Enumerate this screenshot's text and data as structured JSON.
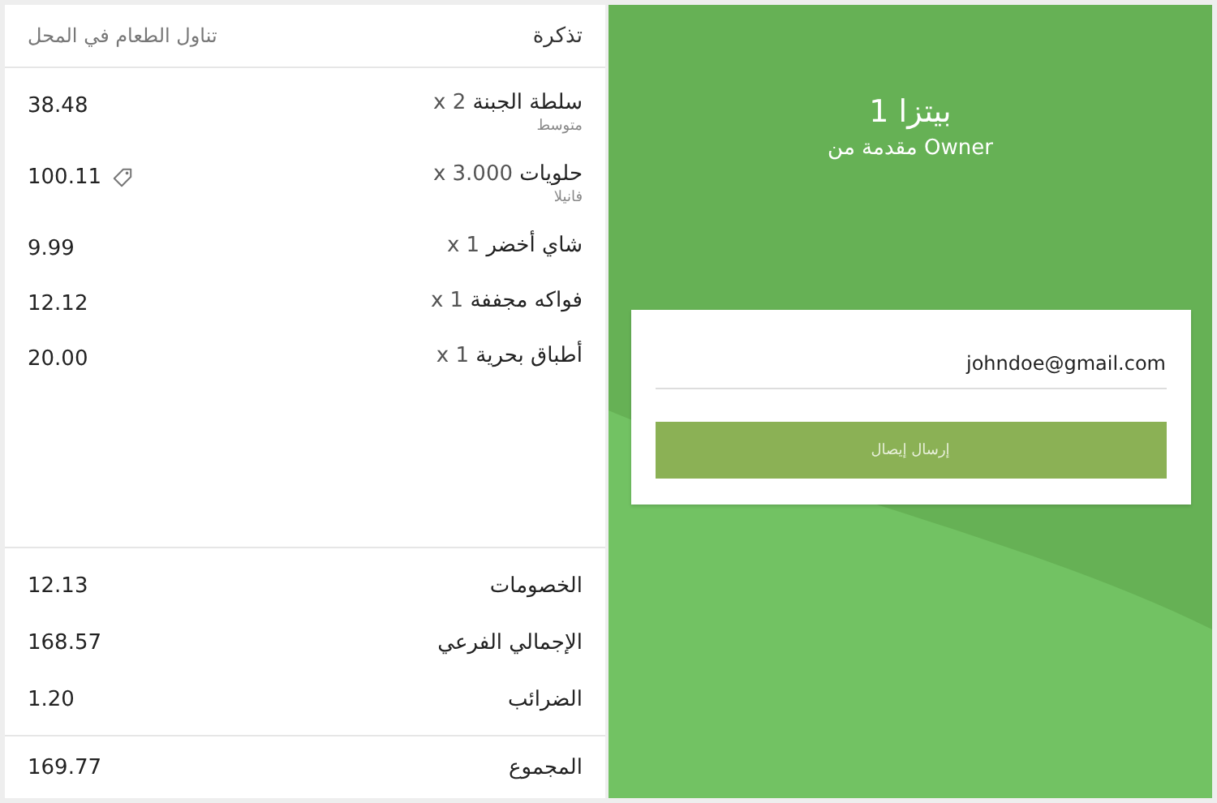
{
  "ticket": {
    "title": "تذكرة",
    "order_type": "تناول الطعام في المحل"
  },
  "items": [
    {
      "name": "سلطة الجبنة",
      "quantity": "x 2",
      "option": "متوسط",
      "price": "38.48",
      "discounted": false
    },
    {
      "name": "حلويات",
      "quantity": "x 3.000",
      "option": "فانيلا",
      "price": "100.11",
      "discounted": true
    },
    {
      "name": "شاي أخضر",
      "quantity": "x 1",
      "price": "9.99",
      "discounted": false
    },
    {
      "name": "فواكه مجففة",
      "quantity": "x 1",
      "price": "12.12",
      "discounted": false
    },
    {
      "name": "أطباق بحرية",
      "quantity": "x 1",
      "price": "20.00",
      "discounted": false
    }
  ],
  "summary": [
    {
      "label": "الخصومات",
      "value": "12.13"
    },
    {
      "label": "الإجمالي الفرعي",
      "value": "168.57"
    },
    {
      "label": "الضرائب",
      "value": "1.20"
    }
  ],
  "total": {
    "label": "المجموع",
    "value": "169.77"
  },
  "receipt": {
    "title": "بيتزا 1",
    "subtitle": "مقدمة من Owner",
    "email": "johndoe@gmail.com",
    "button": "إرسال إيصال"
  }
}
